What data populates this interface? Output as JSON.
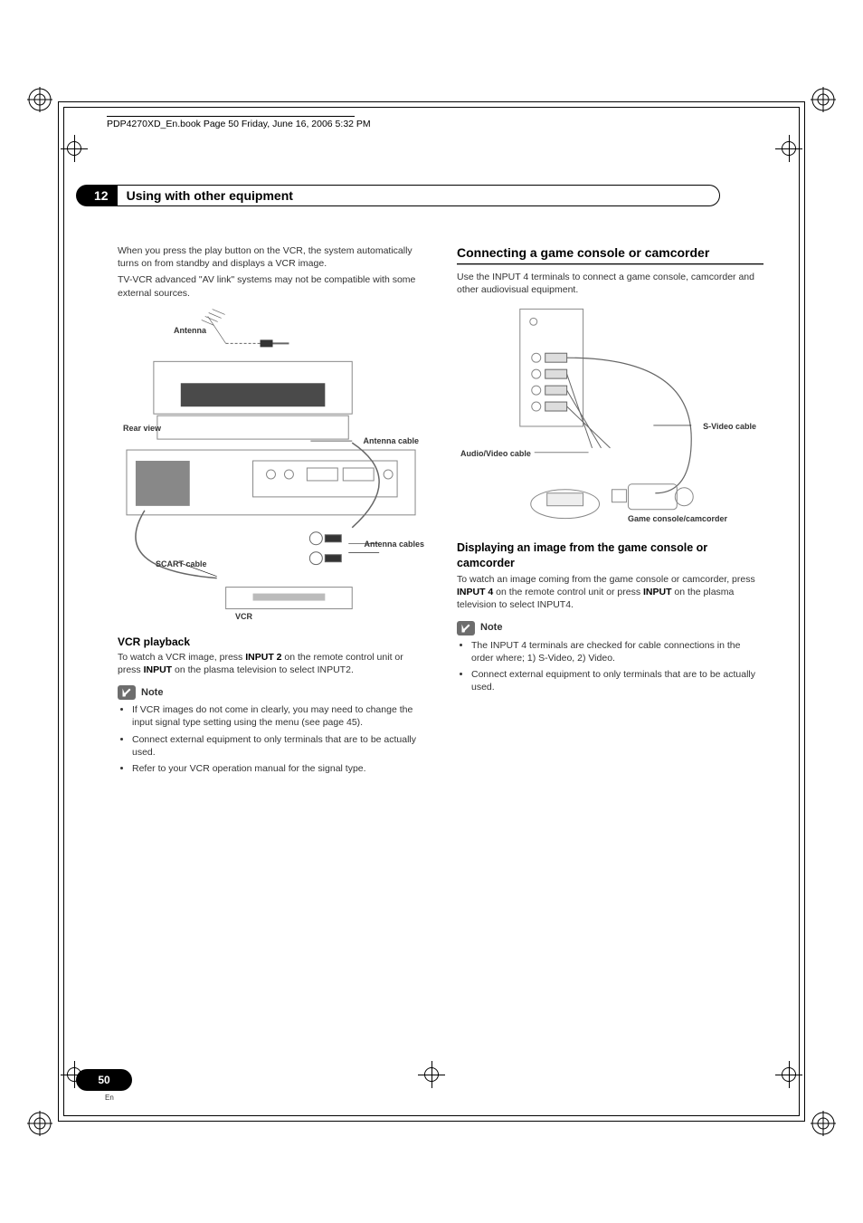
{
  "header": {
    "book_info": "PDP4270XD_En.book  Page 50  Friday, June 16, 2006  5:32 PM"
  },
  "chapter": {
    "number": "12",
    "title": "Using with other equipment"
  },
  "left_column": {
    "intro_p1": "When you press the play button on the VCR, the system automatically turns on from standby and displays a VCR image.",
    "intro_p2": "TV-VCR advanced \"AV link\" systems may not be compatible with some external sources.",
    "diagram": {
      "antenna_label": "Antenna",
      "rear_view_label": "Rear view",
      "antenna_cable_label": "Antenna cable",
      "antenna_cables_label": "Antenna cables",
      "scart_cable_label": "SCART cable",
      "vcr_label": "VCR"
    },
    "vcr_playback_heading": "VCR playback",
    "vcr_playback_text_pre": "To watch a VCR image, press ",
    "vcr_playback_bold1": "INPUT 2",
    "vcr_playback_text_mid": " on the remote control unit or press ",
    "vcr_playback_bold2": "INPUT",
    "vcr_playback_text_end": " on the plasma television to select INPUT2.",
    "note_label": "Note",
    "notes": [
      "If VCR images do not come in clearly, you may need to change the input signal type setting using the menu (see page 45).",
      "Connect external equipment to only terminals that are to be actually used.",
      "Refer to your VCR operation manual for the signal type."
    ]
  },
  "right_column": {
    "section_heading": "Connecting a game console or camcorder",
    "intro": "Use the INPUT 4 terminals to connect a game console, camcorder and other audiovisual equipment.",
    "diagram": {
      "svideo_label": "S-Video cable",
      "av_cable_label": "Audio/Video cable",
      "game_label": "Game console/camcorder"
    },
    "display_heading": "Displaying an image from the game console or camcorder",
    "display_text_pre": "To watch an image coming from the game console or camcorder, press ",
    "display_bold1": "INPUT 4",
    "display_text_mid": " on the remote control unit or press ",
    "display_bold2": "INPUT",
    "display_text_end": " on the plasma television to select INPUT4.",
    "note_label": "Note",
    "notes": [
      "The INPUT 4 terminals are checked for cable connections in the order where; 1) S-Video, 2) Video.",
      "Connect external equipment to only terminals that are to be actually used."
    ]
  },
  "footer": {
    "page_number": "50",
    "lang": "En"
  }
}
